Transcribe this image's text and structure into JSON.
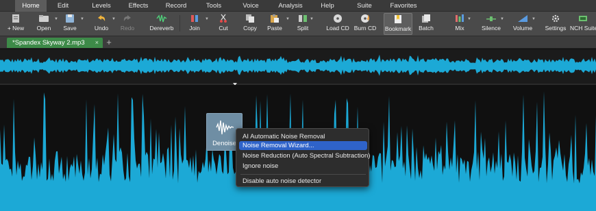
{
  "menubar": {
    "items": [
      {
        "label": "Home"
      },
      {
        "label": "Edit"
      },
      {
        "label": "Levels"
      },
      {
        "label": "Effects"
      },
      {
        "label": "Record"
      },
      {
        "label": "Tools"
      },
      {
        "label": "Voice"
      },
      {
        "label": "Analysis"
      },
      {
        "label": "Help"
      },
      {
        "label": "Suite"
      },
      {
        "label": "Favorites"
      }
    ]
  },
  "toolbar": {
    "new": "+ New",
    "open": "Open",
    "save": "Save",
    "undo": "Undo",
    "redo": "Redo",
    "dereverb": "Dereverb",
    "join": "Join",
    "cut": "Cut",
    "copy": "Copy",
    "paste": "Paste",
    "split": "Split",
    "load_cd": "Load CD",
    "burn_cd": "Burn CD",
    "bookmark": "Bookmark",
    "batch": "Batch",
    "mix": "Mix",
    "silence": "Silence",
    "volume": "Volume",
    "settings": "Settings",
    "nch_suite": "NCH Suite"
  },
  "tabs": {
    "file_tab": "*Spandex Skyway 2.mp3",
    "close": "×",
    "add": "+"
  },
  "colors": {
    "waveform": "#1ca9d6",
    "tab_active": "#3d8a48",
    "menu_selected": "#2f63c9"
  },
  "denoise": {
    "label": "Denoise"
  },
  "context_menu": {
    "items": [
      "AI Automatic Noise Removal",
      "Noise Removal Wizard...",
      "Noise Reduction (Auto Spectral Subtraction)",
      "Ignore noise",
      "Disable auto noise detector"
    ],
    "selected": "Noise Removal Wizard..."
  }
}
